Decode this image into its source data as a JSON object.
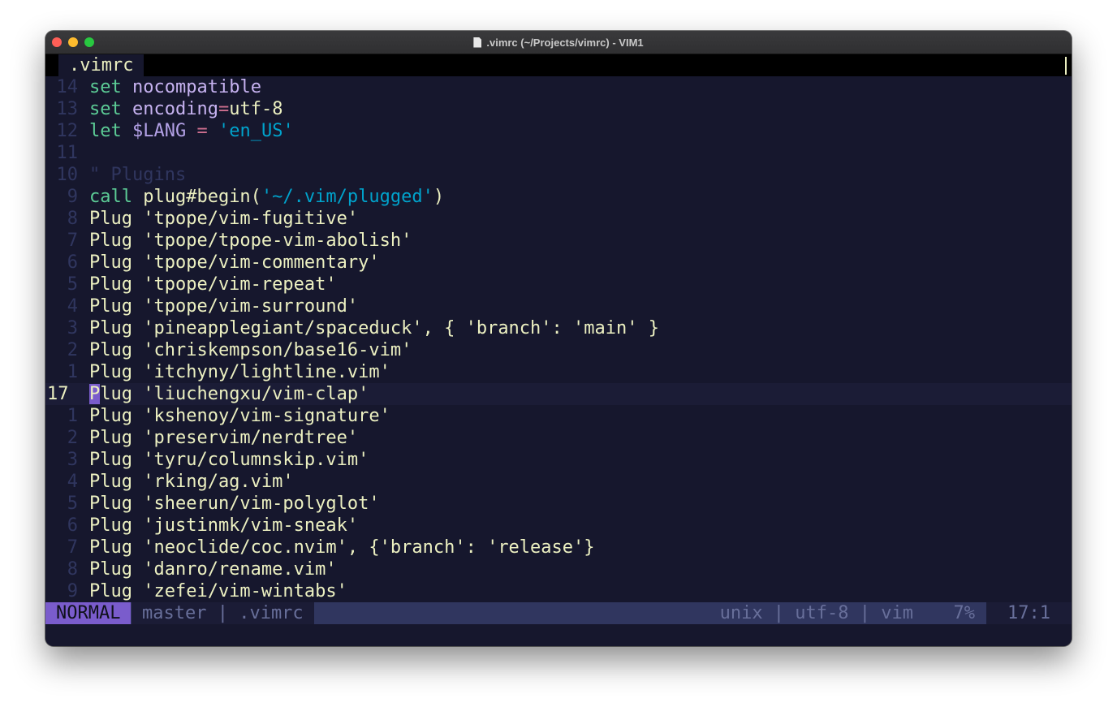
{
  "window": {
    "title": ".vimrc (~/Projects/vimrc) - VIM1"
  },
  "tabline": {
    "active_tab": ".vimrc"
  },
  "editor": {
    "lines": [
      {
        "num": "14",
        "tokens": [
          [
            "kw",
            "set"
          ],
          [
            "",
            " "
          ],
          [
            "ident",
            "nocompatible"
          ]
        ]
      },
      {
        "num": "13",
        "tokens": [
          [
            "kw",
            "set"
          ],
          [
            "",
            " "
          ],
          [
            "ident",
            "encoding"
          ],
          [
            "op",
            "="
          ],
          [
            "",
            "utf-8"
          ]
        ]
      },
      {
        "num": "12",
        "tokens": [
          [
            "kw",
            "let"
          ],
          [
            "",
            " "
          ],
          [
            "var",
            "$LANG"
          ],
          [
            "",
            " "
          ],
          [
            "op",
            "="
          ],
          [
            "",
            " "
          ],
          [
            "str",
            "'en_US'"
          ]
        ]
      },
      {
        "num": "11",
        "tokens": []
      },
      {
        "num": "10",
        "tokens": [
          [
            "cmt",
            "\" Plugins"
          ]
        ]
      },
      {
        "num": "9",
        "tokens": [
          [
            "kw",
            "call"
          ],
          [
            "",
            " plug#begin("
          ],
          [
            "str",
            "'~/.vim/plugged'"
          ],
          [
            "",
            ")"
          ]
        ]
      },
      {
        "num": "8",
        "tokens": [
          [
            "",
            "Plug 'tpope/vim-fugitive'"
          ]
        ]
      },
      {
        "num": "7",
        "tokens": [
          [
            "",
            "Plug 'tpope/tpope-vim-abolish'"
          ]
        ]
      },
      {
        "num": "6",
        "tokens": [
          [
            "",
            "Plug 'tpope/vim-commentary'"
          ]
        ]
      },
      {
        "num": "5",
        "tokens": [
          [
            "",
            "Plug 'tpope/vim-repeat'"
          ]
        ]
      },
      {
        "num": "4",
        "tokens": [
          [
            "",
            "Plug 'tpope/vim-surround'"
          ]
        ]
      },
      {
        "num": "3",
        "tokens": [
          [
            "",
            "Plug 'pineapplegiant/spaceduck', { 'branch': 'main' }"
          ]
        ]
      },
      {
        "num": "2",
        "tokens": [
          [
            "",
            "Plug 'chriskempson/base16-vim'"
          ]
        ]
      },
      {
        "num": "1",
        "tokens": [
          [
            "",
            "Plug 'itchyny/lightline.vim'"
          ]
        ]
      },
      {
        "num": "17",
        "current": true,
        "tokens": [
          [
            "cursor",
            "P"
          ],
          [
            "",
            "lug 'liuchengxu/vim-clap'"
          ]
        ]
      },
      {
        "num": "1",
        "tokens": [
          [
            "",
            "Plug 'kshenoy/vim-signature'"
          ]
        ]
      },
      {
        "num": "2",
        "tokens": [
          [
            "",
            "Plug 'preservim/nerdtree'"
          ]
        ]
      },
      {
        "num": "3",
        "tokens": [
          [
            "",
            "Plug 'tyru/columnskip.vim'"
          ]
        ]
      },
      {
        "num": "4",
        "tokens": [
          [
            "",
            "Plug 'rking/ag.vim'"
          ]
        ]
      },
      {
        "num": "5",
        "tokens": [
          [
            "",
            "Plug 'sheerun/vim-polyglot'"
          ]
        ]
      },
      {
        "num": "6",
        "tokens": [
          [
            "",
            "Plug 'justinmk/vim-sneak'"
          ]
        ]
      },
      {
        "num": "7",
        "tokens": [
          [
            "",
            "Plug 'neoclide/coc.nvim', {'branch': 'release'}"
          ]
        ]
      },
      {
        "num": "8",
        "tokens": [
          [
            "",
            "Plug 'danro/rename.vim'"
          ]
        ]
      },
      {
        "num": "9",
        "tokens": [
          [
            "",
            "Plug 'zefei/vim-wintabs'"
          ]
        ]
      }
    ]
  },
  "statusline": {
    "mode": "NORMAL",
    "branch_file": "master | .vimrc",
    "encoding_info": "unix | utf-8 | vim",
    "percent": "7%",
    "position": "17:1"
  },
  "colors": {
    "background": "#16172d",
    "foreground": "#ecf0c1",
    "keyword": "#5ccc96",
    "string": "#00a3cc",
    "identifier": "#c6b2f0",
    "operator": "#ce6f8f",
    "comment": "#30365f",
    "mode_accent": "#7a5ccc"
  }
}
